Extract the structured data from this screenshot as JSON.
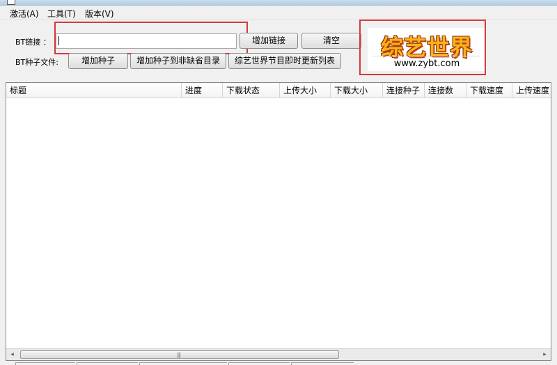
{
  "menu": {
    "activate": "激活(A)",
    "tools": "工具(T)",
    "version": "版本(V)"
  },
  "bt_link": {
    "label": "BT链接 ：",
    "value": "",
    "add_button": "增加链接",
    "clear_button": "清空"
  },
  "torrent": {
    "label": "BT种子文件:",
    "add_button": "增加种子",
    "add_nondefault_button": "增加种子到非缺省目录",
    "update_list_button": "综艺世界节目即时更新列表"
  },
  "logo": {
    "title": "综艺世界",
    "url": "www.zybt.com"
  },
  "list": {
    "columns": [
      "标题",
      "进度",
      "下载状态",
      "上传大小",
      "下载大小",
      "连接种子",
      "连接数",
      "下载速度",
      "上传速度"
    ],
    "rows": []
  },
  "scrollbar": {
    "left_arrow": "◂",
    "right_arrow": "▸",
    "grip": "|||"
  },
  "colors": {
    "highlight_border": "#d43a3a",
    "logo_text": "#f3b51b"
  }
}
